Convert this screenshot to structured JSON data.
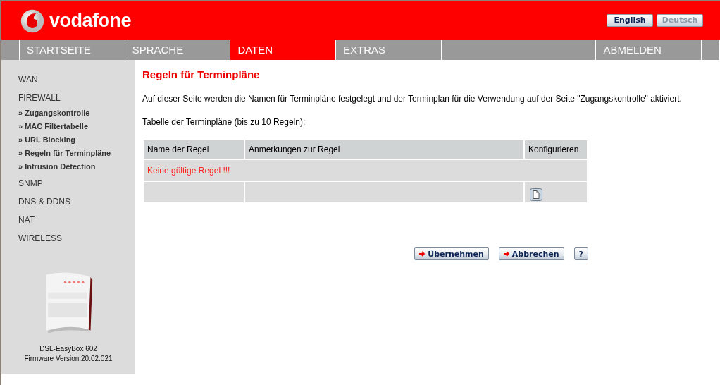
{
  "brand": "vodafone",
  "languages": [
    {
      "label": "English",
      "selected": true
    },
    {
      "label": "Deutsch",
      "selected": false
    }
  ],
  "nav": [
    {
      "kind": "spacer"
    },
    {
      "label": "STARTSEITE",
      "selected": false,
      "kind": "tab"
    },
    {
      "label": "SPRACHE",
      "selected": false,
      "kind": "tab"
    },
    {
      "label": "DATEN",
      "selected": true,
      "kind": "tab"
    },
    {
      "label": "EXTRAS",
      "selected": false,
      "kind": "tab"
    },
    {
      "kind": "filler"
    },
    {
      "label": "ABMELDEN",
      "selected": false,
      "kind": "tab"
    },
    {
      "kind": "spacer"
    }
  ],
  "sidebar": {
    "items": [
      {
        "label": "WAN"
      },
      {
        "label": "FIREWALL",
        "children": [
          {
            "label": "» Zugangskontrolle"
          },
          {
            "label": "» MAC Filtertabelle"
          },
          {
            "label": "» URL Blocking"
          },
          {
            "label": "» Regeln für Terminpläne"
          },
          {
            "label": "» Intrusion Detection"
          }
        ]
      },
      {
        "label": "SNMP"
      },
      {
        "label": "DNS & DDNS"
      },
      {
        "label": "NAT"
      },
      {
        "label": "WIRELESS"
      }
    ],
    "device": {
      "kind": "picture",
      "model": "DSL-EasyBox 602",
      "firmware": "Firmware Version:20.02.021"
    }
  },
  "page": {
    "title": "Regeln für Terminpläne",
    "description": "Auf dieser Seite werden die Namen für Terminpläne festgelegt und der Terminplan für die Verwendung auf der Seite \"Zugangskontrolle\" aktiviert.",
    "table_caption": "Tabelle der Terminpläne (bis zu 10 Regeln):"
  },
  "table": {
    "columns": [
      "Name der Regel",
      "Anmerkungen zur Regel",
      "Konfigurieren"
    ],
    "rows": [
      {
        "kind": "message",
        "text": "Keine gültige Regel !!!"
      },
      {
        "kind": "add"
      }
    ]
  },
  "buttons": [
    {
      "kind": "arrow",
      "label": "Übernehmen"
    },
    {
      "kind": "arrow",
      "label": "Abbrechen"
    },
    {
      "kind": "plain",
      "label": "?"
    }
  ]
}
